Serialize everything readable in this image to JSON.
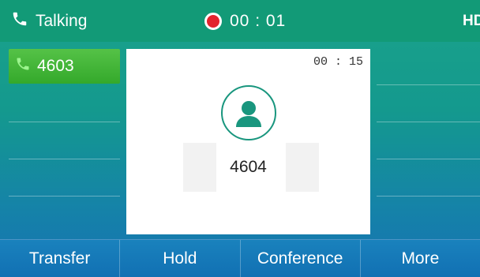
{
  "status_bar": {
    "call_state": "Talking",
    "timer": "00 : 01",
    "hd_label": "HD"
  },
  "lines": [
    {
      "label": "4603",
      "active": true
    }
  ],
  "call_card": {
    "duration": "00 : 15",
    "callee": "4604"
  },
  "softkeys": {
    "transfer": "Transfer",
    "hold": "Hold",
    "conference": "Conference",
    "more": "More"
  },
  "colors": {
    "status_bar": "#129a77",
    "active_line": "#3fb235",
    "recording": "#e3232d",
    "softkey_bar": "#1478b8"
  }
}
